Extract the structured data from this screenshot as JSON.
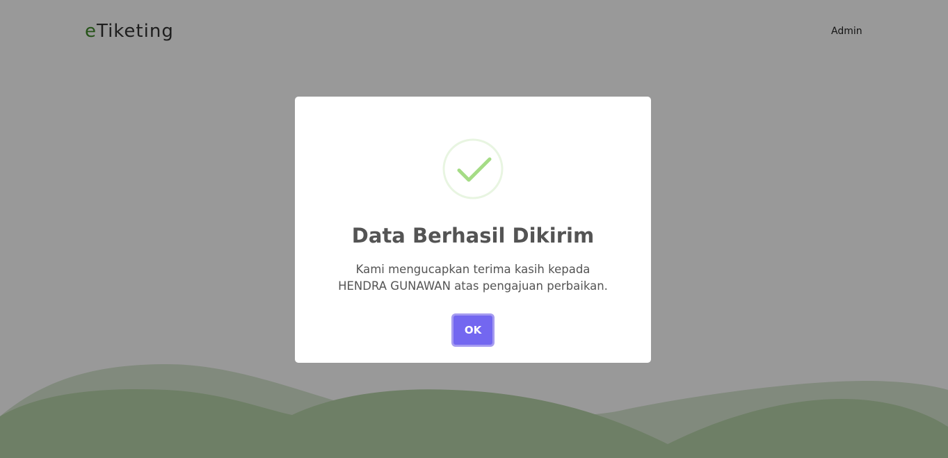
{
  "header": {
    "brand_accent": "e",
    "brand_rest": "Tiketing",
    "admin_label": "Admin"
  },
  "modal": {
    "title": "Data Berhasil Dikirim",
    "message": "Kami mengucapkan terima kasih kepada HENDRA GUNAWAN atas pengajuan perbaikan.",
    "confirm_label": "OK",
    "icon": "check-circle-icon"
  },
  "colors": {
    "brand_accent": "#3f8a28",
    "success": "#a5dc86",
    "confirm_button": "#7367f0",
    "backdrop": "rgba(0,0,0,0.4)"
  }
}
